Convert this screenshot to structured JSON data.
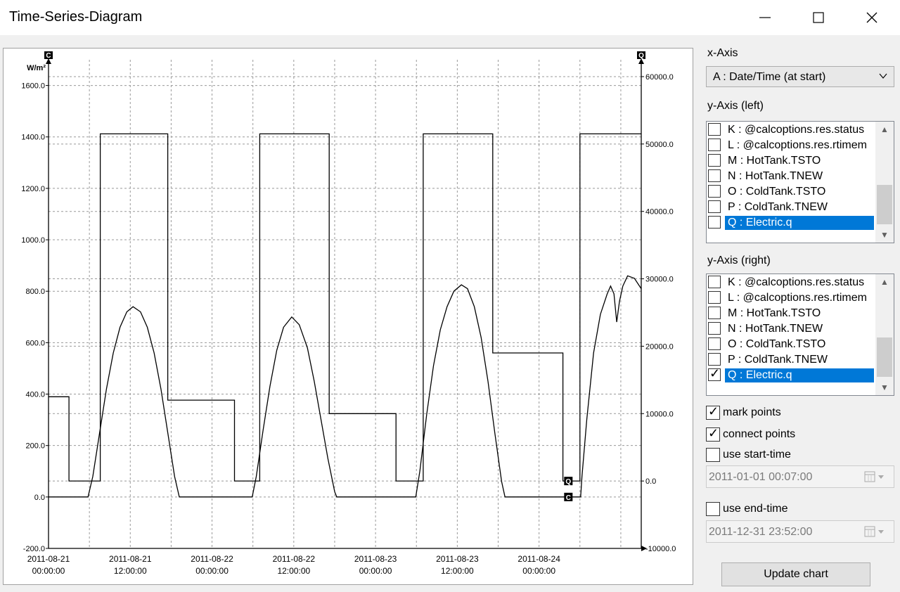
{
  "window": {
    "title": "Time-Series-Diagram"
  },
  "panel": {
    "x_axis_label": "x-Axis",
    "x_axis_value": "A : Date/Time (at start)",
    "y_left_label": "y-Axis (left)",
    "y_right_label": "y-Axis (right)",
    "y_left_items": [
      {
        "label": "K : @calcoptions.res.status",
        "checked": false,
        "selected": false
      },
      {
        "label": "L : @calcoptions.res.rtimem",
        "checked": false,
        "selected": false
      },
      {
        "label": "M : HotTank.TSTO",
        "checked": false,
        "selected": false
      },
      {
        "label": "N : HotTank.TNEW",
        "checked": false,
        "selected": false
      },
      {
        "label": "O : ColdTank.TSTO",
        "checked": false,
        "selected": false
      },
      {
        "label": "P : ColdTank.TNEW",
        "checked": false,
        "selected": false
      },
      {
        "label": "Q : Electric.q",
        "checked": false,
        "selected": true
      }
    ],
    "y_right_items": [
      {
        "label": "K : @calcoptions.res.status",
        "checked": false,
        "selected": false
      },
      {
        "label": "L : @calcoptions.res.rtimem",
        "checked": false,
        "selected": false
      },
      {
        "label": "M : HotTank.TSTO",
        "checked": false,
        "selected": false
      },
      {
        "label": "N : HotTank.TNEW",
        "checked": false,
        "selected": false
      },
      {
        "label": "O : ColdTank.TSTO",
        "checked": false,
        "selected": false
      },
      {
        "label": "P : ColdTank.TNEW",
        "checked": false,
        "selected": false
      },
      {
        "label": "Q : Electric.q",
        "checked": true,
        "selected": true
      }
    ],
    "mark_points": {
      "label": "mark points",
      "checked": true
    },
    "connect_points": {
      "label": "connect points",
      "checked": true
    },
    "use_start_time": {
      "label": "use start-time",
      "checked": false
    },
    "start_time_value": "2011-01-01 00:07:00",
    "use_end_time": {
      "label": "use end-time",
      "checked": false
    },
    "end_time_value": "2011-12-31 23:52:00",
    "update_button": "Update chart"
  },
  "chart_data": {
    "type": "line",
    "title": "",
    "left_axis": {
      "unit": "W/m²",
      "min": -200,
      "max": 1700,
      "ticks": [
        "-200.0",
        "0.0",
        "200.0",
        "400.0",
        "600.0",
        "800.0",
        "1000.0",
        "1200.0",
        "1400.0",
        "1600.0"
      ],
      "marker": "C"
    },
    "right_axis": {
      "min": -10000,
      "max": 62500,
      "ticks": [
        "-10000.0",
        "0.0",
        "10000.0",
        "20000.0",
        "30000.0",
        "40000.0",
        "50000.0",
        "60000.0"
      ],
      "marker": "Q"
    },
    "x_axis": {
      "min_hours": 0,
      "max_hours": 87,
      "tick_labels": [
        {
          "h": 0,
          "date": "2011-08-21",
          "time": "00:00:00"
        },
        {
          "h": 12,
          "date": "2011-08-21",
          "time": "12:00:00"
        },
        {
          "h": 24,
          "date": "2011-08-22",
          "time": "00:00:00"
        },
        {
          "h": 36,
          "date": "2011-08-22",
          "time": "12:00:00"
        },
        {
          "h": 48,
          "date": "2011-08-23",
          "time": "00:00:00"
        },
        {
          "h": 60,
          "date": "2011-08-23",
          "time": "12:00:00"
        },
        {
          "h": 72,
          "date": "2011-08-24",
          "time": "00:00:00"
        }
      ],
      "grid_hours": [
        0,
        6,
        12,
        18,
        24,
        30,
        36,
        42,
        48,
        54,
        60,
        66,
        72,
        78,
        84
      ]
    },
    "grid": true,
    "series": [
      {
        "axis": "right",
        "points": [
          [
            0,
            12500
          ],
          [
            3,
            12500
          ],
          [
            3,
            0
          ],
          [
            6,
            0
          ],
          [
            7.6,
            0
          ],
          [
            7.6,
            51500
          ],
          [
            17.5,
            51500
          ],
          [
            17.5,
            12000
          ],
          [
            27.3,
            12000
          ],
          [
            27.3,
            0
          ],
          [
            30.6,
            0
          ],
          [
            31,
            0
          ],
          [
            31,
            51500
          ],
          [
            41.2,
            51500
          ],
          [
            41.2,
            10000
          ],
          [
            51,
            10000
          ],
          [
            51,
            0
          ],
          [
            54.5,
            0
          ],
          [
            55,
            0
          ],
          [
            55,
            51500
          ],
          [
            65.2,
            51500
          ],
          [
            65.2,
            19000
          ],
          [
            75.5,
            19000
          ],
          [
            75.5,
            0
          ],
          [
            78,
            0
          ],
          [
            78,
            51500
          ],
          [
            87,
            51500
          ]
        ]
      },
      {
        "axis": "left",
        "points": [
          [
            0,
            0
          ],
          [
            5.8,
            0
          ],
          [
            6.5,
            80
          ],
          [
            7.5,
            250
          ],
          [
            8.5,
            420
          ],
          [
            9.5,
            560
          ],
          [
            10.5,
            660
          ],
          [
            11.5,
            720
          ],
          [
            12.4,
            740
          ],
          [
            13.5,
            720
          ],
          [
            14.5,
            660
          ],
          [
            15.5,
            560
          ],
          [
            16.5,
            420
          ],
          [
            17.5,
            250
          ],
          [
            18.5,
            80
          ],
          [
            19.2,
            0
          ],
          [
            29.9,
            0
          ],
          [
            30.5,
            80
          ],
          [
            31.5,
            260
          ],
          [
            32.5,
            430
          ],
          [
            33.5,
            570
          ],
          [
            34.5,
            660
          ],
          [
            35.7,
            700
          ],
          [
            36.8,
            670
          ],
          [
            38,
            580
          ],
          [
            39,
            450
          ],
          [
            40,
            300
          ],
          [
            41,
            150
          ],
          [
            42,
            20
          ],
          [
            42.3,
            0
          ],
          [
            53.9,
            0
          ],
          [
            54.5,
            100
          ],
          [
            55.5,
            320
          ],
          [
            56.5,
            510
          ],
          [
            57.5,
            650
          ],
          [
            58.5,
            740
          ],
          [
            59.5,
            800
          ],
          [
            60.6,
            825
          ],
          [
            61.5,
            810
          ],
          [
            62.5,
            740
          ],
          [
            63.5,
            620
          ],
          [
            64.5,
            450
          ],
          [
            65.5,
            250
          ],
          [
            66.5,
            60
          ],
          [
            67,
            0
          ],
          [
            78.1,
            0
          ],
          [
            78.3,
            80
          ],
          [
            79,
            300
          ],
          [
            80,
            560
          ],
          [
            81,
            710
          ],
          [
            82,
            790
          ],
          [
            82.5,
            820
          ],
          [
            83,
            790
          ],
          [
            83.4,
            680
          ],
          [
            83.8,
            760
          ],
          [
            84.3,
            820
          ],
          [
            85,
            860
          ],
          [
            86,
            850
          ],
          [
            87,
            810
          ]
        ]
      }
    ],
    "end_markers": [
      {
        "label": "Q",
        "axis": "right",
        "h": 76.3,
        "v": 0
      },
      {
        "label": "C",
        "axis": "left",
        "h": 76.3,
        "v": 0
      }
    ]
  }
}
